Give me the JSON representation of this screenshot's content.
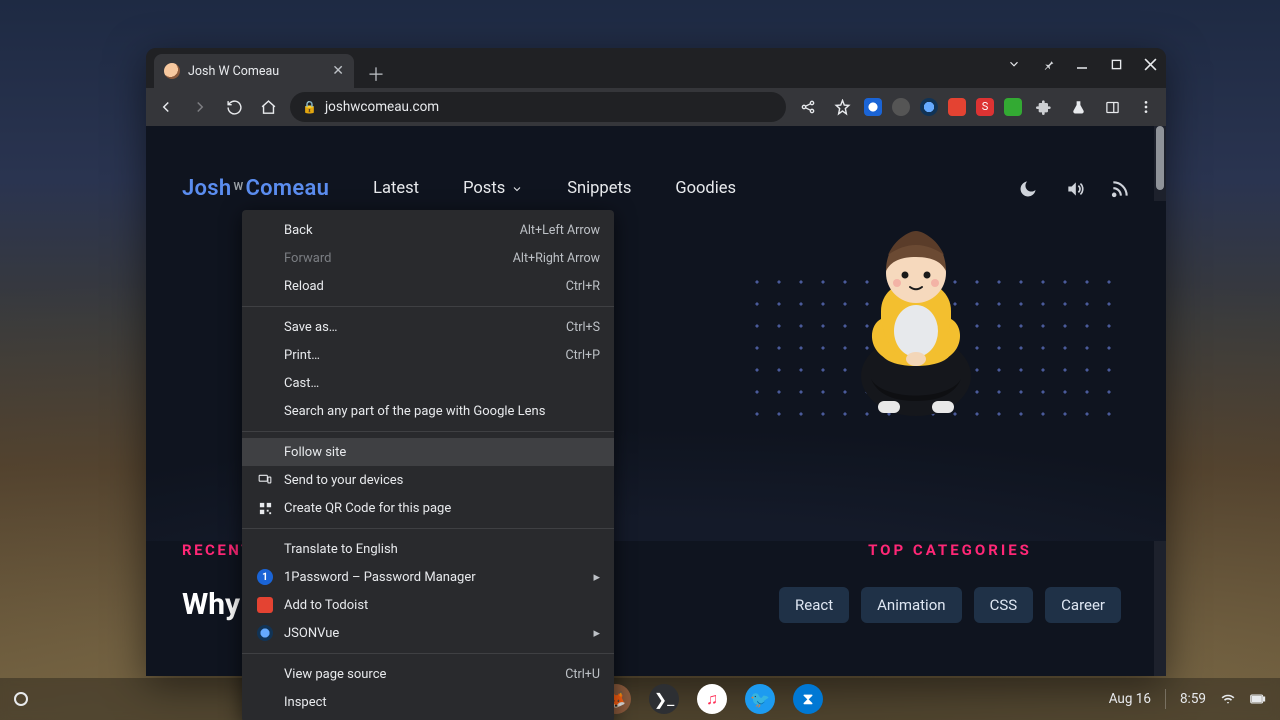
{
  "browser": {
    "tab_title": "Josh W Comeau",
    "url": "joshwcomeau.com",
    "nav": {
      "back_enabled": true,
      "forward_enabled": false
    },
    "extensions": [
      "1password-ext",
      "block-ext",
      "jsonvue-ext",
      "todoist-ext",
      "s-ext",
      "green-ext"
    ]
  },
  "context_menu": {
    "hovered_index": 8,
    "items": [
      {
        "label": "Back",
        "accel": "Alt+Left Arrow"
      },
      {
        "label": "Forward",
        "accel": "Alt+Right Arrow",
        "disabled": true
      },
      {
        "label": "Reload",
        "accel": "Ctrl+R"
      },
      {
        "sep": true
      },
      {
        "label": "Save as…",
        "accel": "Ctrl+S"
      },
      {
        "label": "Print…",
        "accel": "Ctrl+P"
      },
      {
        "label": "Cast…"
      },
      {
        "label": "Search any part of the page with Google Lens"
      },
      {
        "sep": true
      },
      {
        "label": "Follow site"
      },
      {
        "label": "Send to your devices",
        "icon": "devices"
      },
      {
        "label": "Create QR Code for this page",
        "icon": "qr"
      },
      {
        "sep": true
      },
      {
        "label": "Translate to English"
      },
      {
        "label": "1Password – Password Manager",
        "icon": "1password",
        "submenu": true
      },
      {
        "label": "Add to Todoist",
        "icon": "todoist"
      },
      {
        "label": "JSONVue",
        "icon": "jsonvue",
        "submenu": true
      },
      {
        "sep": true
      },
      {
        "label": "View page source",
        "accel": "Ctrl+U"
      },
      {
        "label": "Inspect"
      }
    ]
  },
  "site": {
    "logo": {
      "part1": "Josh",
      "w": "W",
      "part2": "Comeau"
    },
    "nav": [
      "Latest",
      "Posts",
      "Snippets",
      "Goodies"
    ],
    "recent_label": "RECENT",
    "recent_heading_partial": "Why R",
    "top_categories_label": "TOP CATEGORIES",
    "categories": [
      "React",
      "Animation",
      "CSS",
      "Career"
    ]
  },
  "taskbar": {
    "date": "Aug 16",
    "time": "8:59"
  }
}
